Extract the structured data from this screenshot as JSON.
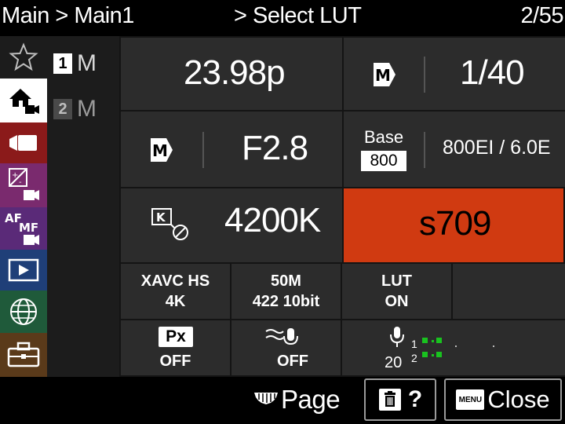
{
  "header": {
    "breadcrumb": "Main > Main1",
    "title": "> Select LUT",
    "page_indicator": "2/55"
  },
  "rail": {
    "items": [
      {
        "icon": "star-icon",
        "bg": "#1c1c1c",
        "selected": false
      },
      {
        "icon": "home-camera-icon",
        "bg": "#ffffff",
        "selected": true
      },
      {
        "icon": "video-camera-icon",
        "bg": "#8b1a1a",
        "selected": false
      },
      {
        "icon": "exposure-color-icon",
        "bg": "#7a2a6e",
        "selected": false
      },
      {
        "icon": "af-mf-icon",
        "bg": "#5a2a78",
        "selected": false
      },
      {
        "icon": "playback-icon",
        "bg": "#1f3f78",
        "selected": false
      },
      {
        "icon": "network-globe-icon",
        "bg": "#1f5a3a",
        "selected": false
      },
      {
        "icon": "toolbox-icon",
        "bg": "#5a3a1a",
        "selected": false
      }
    ]
  },
  "tabs": [
    {
      "num": "1",
      "label": "M",
      "active": true
    },
    {
      "num": "2",
      "label": "M",
      "active": false
    }
  ],
  "cells": {
    "frame_rate": "23.98p",
    "shutter_mode": "M",
    "shutter": "1/40",
    "iris_mode": "M",
    "iris": "F2.8",
    "iso_base_label": "Base",
    "iso_base_value": "800",
    "iso": "800EI / 6.0E",
    "wb_icon_label": "K",
    "white_balance": "4200K",
    "lut_name": "s709",
    "codec_line1": "XAVC HS",
    "codec_line2": "4K",
    "bitrate_line1": "50M",
    "bitrate_line2": "422 10bit",
    "lut_line1": "LUT",
    "lut_line2": "ON",
    "px_badge": "Px",
    "px_state": "OFF",
    "nd_state": "OFF",
    "audio_level": "20",
    "audio_ch1": "1",
    "audio_ch2": "2"
  },
  "footer": {
    "page_label": "Page",
    "delete_help": "?",
    "menu_badge": "MENU",
    "close_label": "Close"
  },
  "colors": {
    "highlight": "#d03a11",
    "cell_bg": "#2c2c2c",
    "grid_bg": "#141414",
    "audio_green": "#19c21f"
  }
}
